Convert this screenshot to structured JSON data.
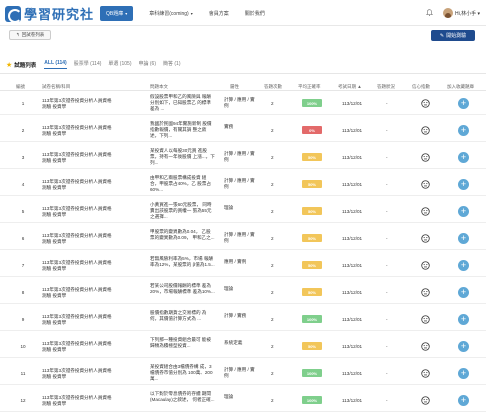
{
  "brand": {
    "name": "學習研究社",
    "color": "#2e6fb6"
  },
  "nav": {
    "items": [
      {
        "label": "QB題庫",
        "caret": "▾",
        "active": true
      },
      {
        "label": "章科練習(coming)",
        "caret": "▾",
        "active": false
      },
      {
        "label": "會員方案",
        "caret": "",
        "active": false
      },
      {
        "label": "關於我們",
        "caret": "",
        "active": false
      }
    ],
    "user_name": "Hi,林小手",
    "user_caret": "▾"
  },
  "toolbar": {
    "back_label": "回試卷列表",
    "start_label": "開始測驗",
    "start_color": "#1f4b8e"
  },
  "tabs": {
    "title": "試題列表",
    "items": [
      {
        "label": "ALL (114)",
        "active": true
      },
      {
        "label": "股票學 (114)",
        "active": false
      },
      {
        "label": "單選 (105)",
        "active": false
      },
      {
        "label": "申論 (6)",
        "active": false
      },
      {
        "label": "簡答 (1)",
        "active": false
      }
    ]
  },
  "table": {
    "headers": [
      "編號",
      "試卷名稱/科目",
      "問題本文",
      "屬性",
      "答題次數",
      "平均正確率",
      "考試日期",
      "答題狀況",
      "信心指數",
      "加入收藏題庫"
    ],
    "sort_indicator": "▲",
    "rows": [
      {
        "idx": "1",
        "name": "113年第3次證券投資分析人員資格測驗 投資學",
        "question": "假設股票甲和乙的風險與 報酬分別如下，已知股票乙 的標準差為 ...",
        "type": "計算 / 應用 / 實例",
        "answers": "2",
        "rate": "100%",
        "rate_color": "#7fcf8c",
        "date": "113/12/01",
        "last": "-"
      },
      {
        "idx": "2",
        "name": "113年第3次證券投資分析人員資格測驗 投資學",
        "question": "我國於民國94年實施新制 股價指數報價，有關其調 整之敘述，下列...",
        "type": "實務",
        "answers": "2",
        "rate": "0%",
        "rate_color": "#e36a6a",
        "date": "113/12/01",
        "last": "-"
      },
      {
        "idx": "3",
        "name": "113年第3次證券投資分析人員資格測驗 投資學",
        "question": "某投資人以每股30元買 進股票，持有一年後股價 上漲...，下列...",
        "type": "計算 / 應用 / 實例",
        "answers": "2",
        "rate": "50%",
        "rate_color": "#f2c65a",
        "date": "113/12/01",
        "last": "-"
      },
      {
        "idx": "4",
        "name": "113年第3次證券投資分析人員資格測驗 投資學",
        "question": "由甲和乙兩股票構成投資 組合，甲股票占40%，乙 股票占60%...",
        "type": "計算 / 應用 / 實例",
        "answers": "2",
        "rate": "50%",
        "rate_color": "#f2c65a",
        "date": "113/12/01",
        "last": "-"
      },
      {
        "idx": "5",
        "name": "113年第3次證券投資分析人員資格測驗 投資學",
        "question": "小黃買進一張60元股票， 同時賣出該股票的買權一 張為55元之選擇...",
        "type": "理論",
        "answers": "2",
        "rate": "50%",
        "rate_color": "#f2c65a",
        "date": "113/12/01",
        "last": "-"
      },
      {
        "idx": "6",
        "name": "113年第3次證券投資分析人員資格測驗 投資學",
        "question": "甲股票的變異數為0.04， 乙股票的變異數為0.09， 甲和乙之...",
        "type": "計算 / 應用 / 實例",
        "answers": "2",
        "rate": "50%",
        "rate_color": "#f2c65a",
        "date": "113/12/01",
        "last": "-"
      },
      {
        "idx": "7",
        "name": "113年第3次證券投資分析人員資格測驗 投資學",
        "question": "若無風險利率為5%，市場 報酬率為12%，某股票的 β值為1.5...",
        "type": "應用 / 實例",
        "answers": "2",
        "rate": "50%",
        "rate_color": "#f2c65a",
        "date": "113/12/01",
        "last": "-"
      },
      {
        "idx": "8",
        "name": "113年第3次證券投資分析人員資格測驗 投資學",
        "question": "若某公司股價報酬的標準 差為20%，市場報酬標準 差為10%...",
        "type": "理論",
        "answers": "2",
        "rate": "50%",
        "rate_color": "#f2c65a",
        "date": "113/12/01",
        "last": "-"
      },
      {
        "idx": "9",
        "name": "113年第3次證券投資分析人員資格測驗 投資學",
        "question": "股價指數期貨之交易標的 為何，其價值計算方式為 ...",
        "type": "計算 / 實務",
        "answers": "2",
        "rate": "100%",
        "rate_color": "#7fcf8c",
        "date": "113/12/01",
        "last": "-"
      },
      {
        "idx": "10",
        "name": "113年第3次證券投資分析人員資格測驗 投資學",
        "question": "下列那一種投資組合最可 能被歸類為積極型投資...",
        "type": "系統定義",
        "answers": "2",
        "rate": "50%",
        "rate_color": "#f2c65a",
        "date": "113/12/01",
        "last": "-"
      },
      {
        "idx": "11",
        "name": "113年第3次證券投資分析人員資格測驗 投資學",
        "question": "某投資組合由3檔債券構 成，3檔債券市值分別為 100萬、200萬...",
        "type": "計算 / 應用 / 實例",
        "answers": "2",
        "rate": "100%",
        "rate_color": "#7fcf8c",
        "date": "113/12/01",
        "last": "-"
      },
      {
        "idx": "12",
        "name": "113年第3次證券投資分析人員資格測驗 投資學",
        "question": "以下對於零息債券的存續 期間(Macaulay)之敘述， 何者正確...",
        "type": "理論",
        "answers": "2",
        "rate": "100%",
        "rate_color": "#7fcf8c",
        "date": "113/12/01",
        "last": "-"
      }
    ]
  }
}
